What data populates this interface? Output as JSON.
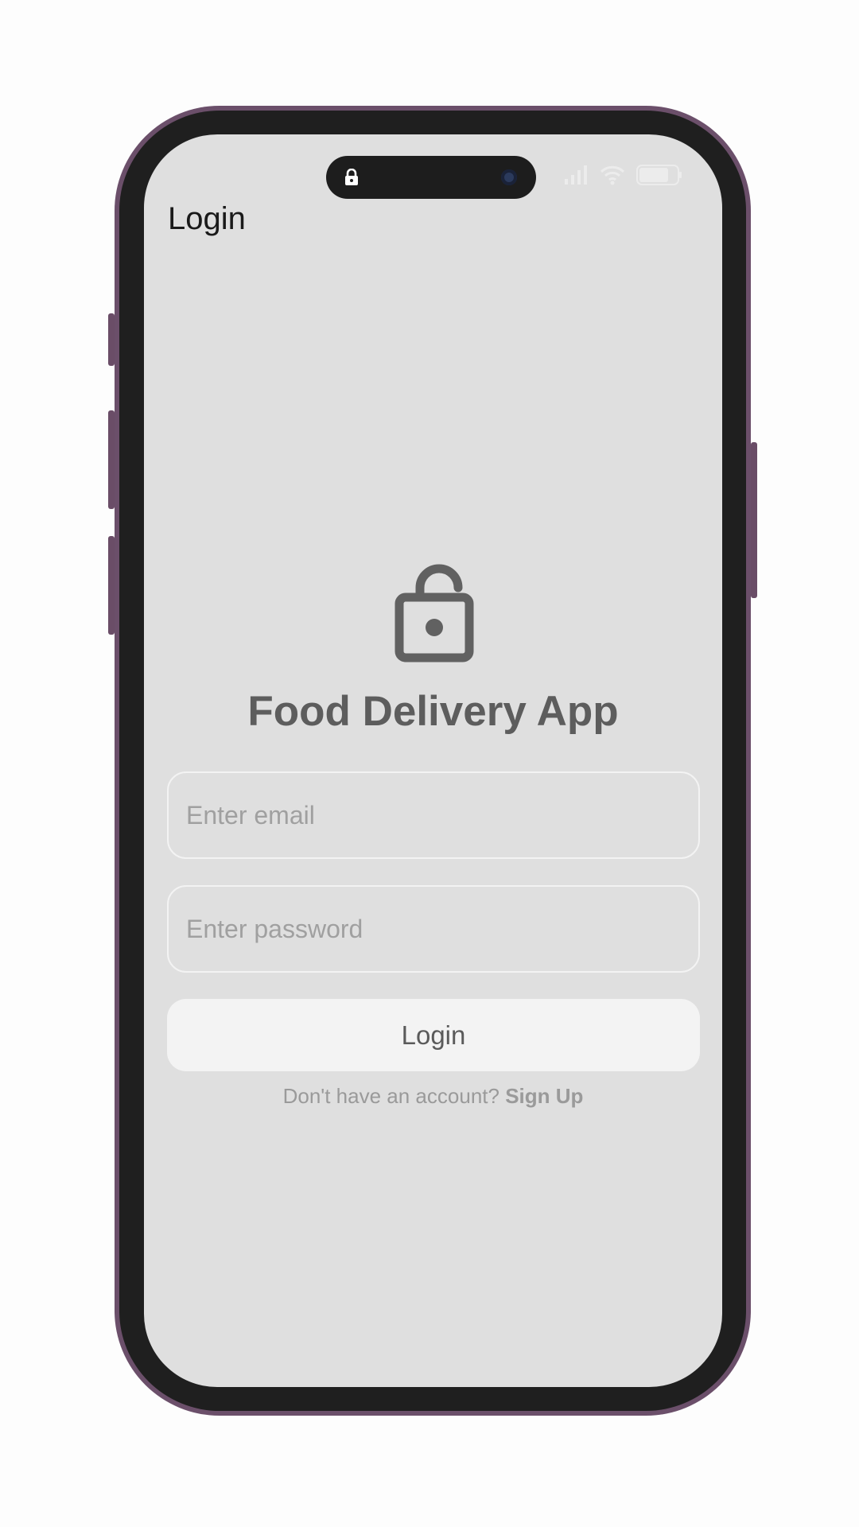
{
  "app_bar": {
    "title": "Login"
  },
  "icons": {
    "island_lock": "lock-icon",
    "camera": "camera-icon",
    "signal": "signal-icon",
    "wifi": "wifi-icon",
    "battery": "battery-icon",
    "hero": "open-lock-icon"
  },
  "main": {
    "brand_title": "Food Delivery App",
    "email": {
      "value": "",
      "placeholder": "Enter email"
    },
    "password": {
      "value": "",
      "placeholder": "Enter password"
    },
    "login_button_label": "Login",
    "signup_prompt": "Don't have an account?",
    "signup_link": "Sign Up"
  },
  "colors": {
    "screen_bg": "#dfdfdf",
    "frame": "#6b4f6a",
    "text_muted": "#9a9a9a",
    "brand_text": "#5d5d5d"
  }
}
